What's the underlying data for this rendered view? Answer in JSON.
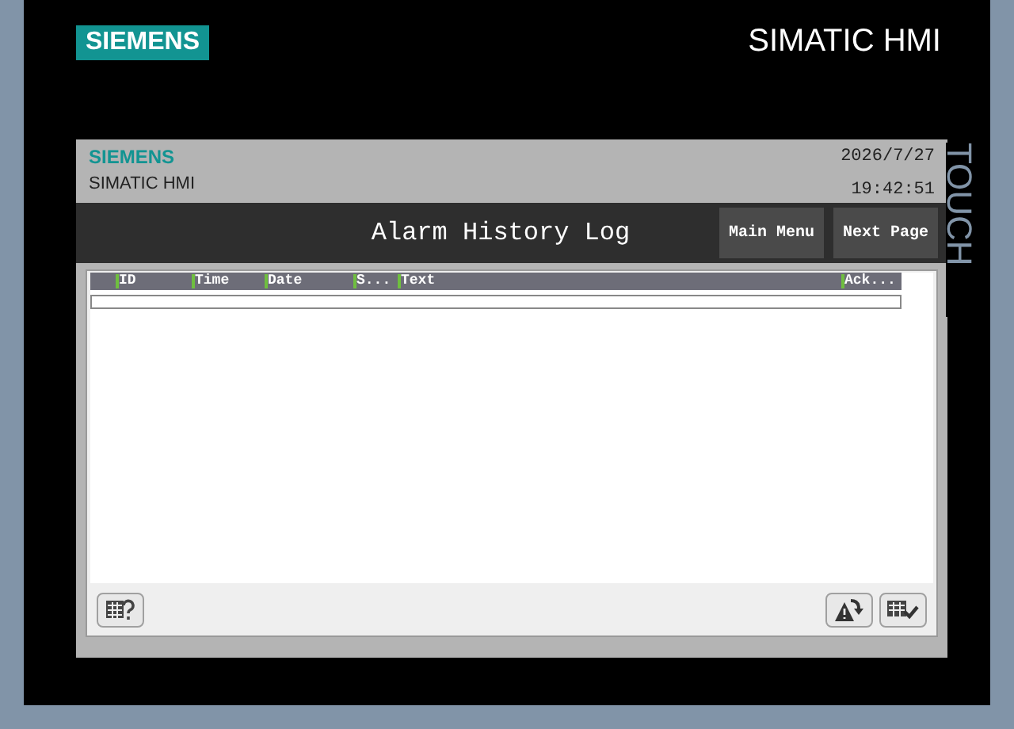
{
  "bezel": {
    "brand": "SIEMENS",
    "product": "SIMATIC HMI",
    "side_label": "TOUCH"
  },
  "header": {
    "brand": "SIEMENS",
    "product": "SIMATIC HMI",
    "date": "2026/7/27",
    "time": "19:42:51"
  },
  "title_bar": {
    "title": "Alarm History Log",
    "buttons": [
      "Main Menu",
      "Next Page"
    ]
  },
  "table": {
    "columns": [
      "ID",
      "Time",
      "Date",
      "S...",
      "Text",
      "Ack..."
    ]
  },
  "toolbar": {
    "left": [
      {
        "kind": "help"
      }
    ],
    "right": [
      {
        "kind": "loop"
      },
      {
        "kind": "ack"
      }
    ]
  }
}
